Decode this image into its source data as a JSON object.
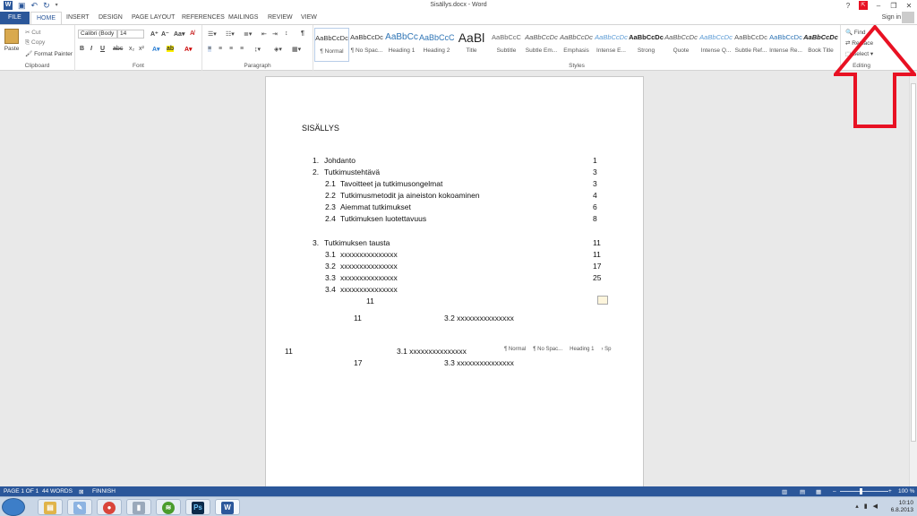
{
  "window": {
    "title": "Sisällys.docx - Word",
    "help": "?",
    "display_options_icon": "ribbon-display-options-icon",
    "minimize": "–",
    "restore": "❐",
    "close": "✕",
    "sign_in": "Sign in"
  },
  "tabs": [
    "FILE",
    "HOME",
    "INSERT",
    "DESIGN",
    "PAGE LAYOUT",
    "REFERENCES",
    "MAILINGS",
    "REVIEW",
    "VIEW"
  ],
  "ribbon": {
    "clipboard": {
      "label": "Clipboard",
      "paste": "Paste",
      "cut": "Cut",
      "copy": "Copy",
      "format_painter": "Format Painter"
    },
    "font": {
      "label": "Font",
      "name": "Calibri (Body",
      "size": "14"
    },
    "paragraph": {
      "label": "Paragraph"
    },
    "styles": {
      "label": "Styles",
      "items": [
        {
          "sample": "AaBbCcDc",
          "name": "¶ Normal"
        },
        {
          "sample": "AaBbCcDc",
          "name": "¶ No Spac..."
        },
        {
          "sample": "AaBbCc",
          "name": "Heading 1"
        },
        {
          "sample": "AaBbCcC",
          "name": "Heading 2"
        },
        {
          "sample": "AaBl",
          "name": "Title"
        },
        {
          "sample": "AaBbCcC",
          "name": "Subtitle"
        },
        {
          "sample": "AaBbCcDc",
          "name": "Subtle Em..."
        },
        {
          "sample": "AaBbCcDc",
          "name": "Emphasis"
        },
        {
          "sample": "AaBbCcDc",
          "name": "Intense E..."
        },
        {
          "sample": "AaBbCcDc",
          "name": "Strong"
        },
        {
          "sample": "AaBbCcDc",
          "name": "Quote"
        },
        {
          "sample": "AaBbCcDc",
          "name": "Intense Q..."
        },
        {
          "sample": "AaBbCcDc",
          "name": "Subtle Ref..."
        },
        {
          "sample": "AaBbCcDc",
          "name": "Intense Re..."
        },
        {
          "sample": "AaBbCcDc",
          "name": "Book Title"
        }
      ]
    },
    "editing": {
      "label": "Editing",
      "find": "Find",
      "replace": "Replace",
      "select": "Select"
    }
  },
  "document": {
    "heading": "SISÄLLYS",
    "toc": [
      {
        "num": "1.",
        "text": "Johdanto",
        "page": "1"
      },
      {
        "num": "2.",
        "text": "Tutkimustehtävä",
        "page": "3"
      },
      {
        "num": "2.1",
        "text": "Tavoitteet ja tutkimusongelmat",
        "page": "3"
      },
      {
        "num": "2.2",
        "text": "Tutkimusmetodit ja aineiston kokoaminen",
        "page": "4"
      },
      {
        "num": "2.3",
        "text": "Aiemmat tutkimukset",
        "page": "6"
      },
      {
        "num": "2.4",
        "text": "Tutkimuksen luotettavuus",
        "page": "8"
      },
      {
        "num": "3.",
        "text": "Tutkimuksen tausta",
        "page": "11"
      },
      {
        "num": "3.1",
        "text": "xxxxxxxxxxxxxxx",
        "page": "11"
      },
      {
        "num": "3.2",
        "text": "xxxxxxxxxxxxxxx",
        "page": "17"
      },
      {
        "num": "3.3",
        "text": "xxxxxxxxxxxxxxx",
        "page": "25"
      },
      {
        "num": "3.4",
        "text": "xxxxxxxxxxxxxxx",
        "page": ""
      }
    ],
    "stray": [
      {
        "text": "11"
      },
      {
        "text": "11"
      },
      {
        "text": "3.2  xxxxxxxxxxxxxxx"
      },
      {
        "text": "11"
      },
      {
        "text": "3.1  xxxxxxxxxxxxxxx"
      },
      {
        "text": "17"
      },
      {
        "text": "3.3  xxxxxxxxxxxxxxx"
      }
    ],
    "mini_styles": [
      "¶ Normal",
      "¶ No Spac...",
      "Heading 1",
      "› Sp"
    ]
  },
  "status": {
    "page": "PAGE 1 OF 1",
    "words": "44 WORDS",
    "language": "FINNISH",
    "zoom": "100 %",
    "zoom_level": 1.0
  },
  "taskbar": {
    "time": "10:10",
    "date": "6.8.2013",
    "apps": [
      "file-explorer",
      "notepad",
      "chrome",
      "media",
      "spotify",
      "photoshop",
      "word"
    ]
  },
  "colors": {
    "accent": "#2b579a",
    "highlight": "#e81123"
  }
}
